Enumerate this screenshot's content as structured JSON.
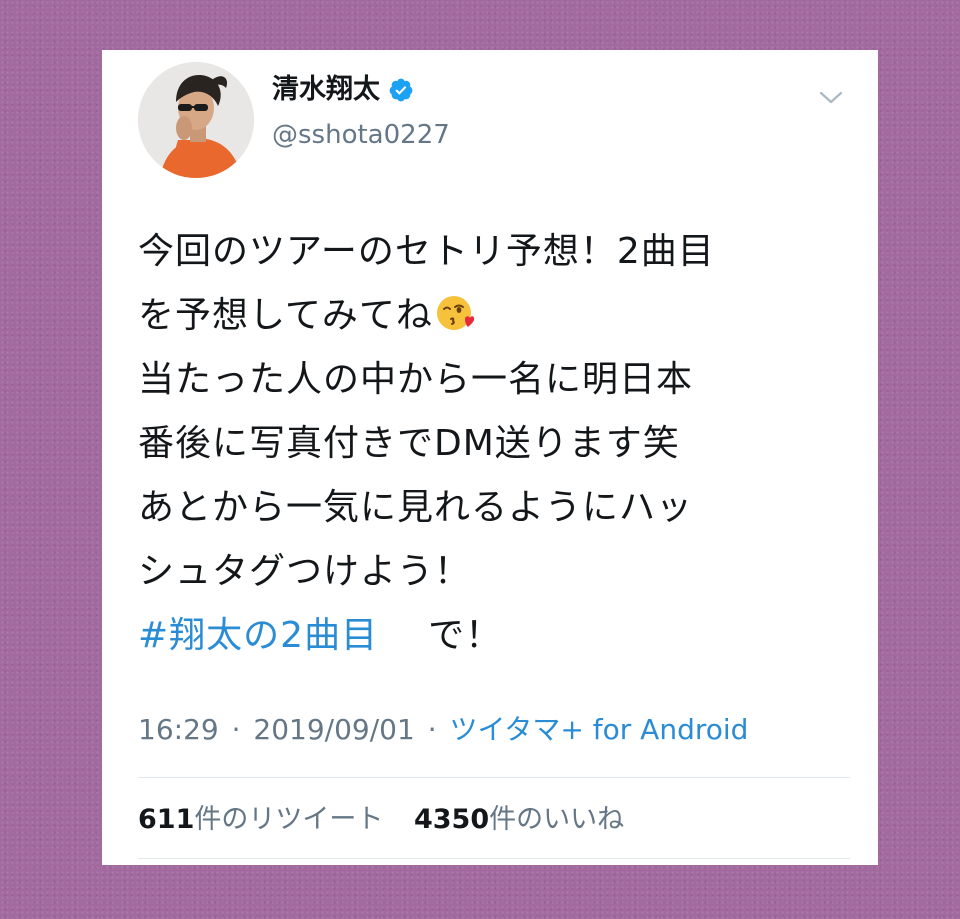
{
  "user": {
    "display_name": "清水翔太",
    "handle": "@sshota0227",
    "verified_icon": "verified-badge-icon",
    "menu_icon": "chevron-down-icon"
  },
  "tweet": {
    "lines": [
      "今回のツアーのセトリ予想！2曲目",
      "を予想してみてね",
      "当たった人の中から一名に明日本",
      "番後に写真付きでDM送ります笑",
      "あとから一気に見れるようにハッ",
      "シュタグつけよう！"
    ],
    "emoji": "face-throwing-kiss-icon",
    "hashtag": "#翔太の2曲目",
    "trailing": "で！"
  },
  "meta": {
    "time": "16:29",
    "separator": "·",
    "date": "2019/09/01",
    "source": "ツイタマ+ for Android"
  },
  "stats": {
    "retweets_count": "611",
    "retweets_label": "件のリツイート",
    "likes_count": "4350",
    "likes_label": "件のいいね"
  },
  "colors": {
    "background": "#a36aa0",
    "link": "#2b8cd6",
    "verified": "#1da1f2",
    "secondary_text": "#657786"
  }
}
